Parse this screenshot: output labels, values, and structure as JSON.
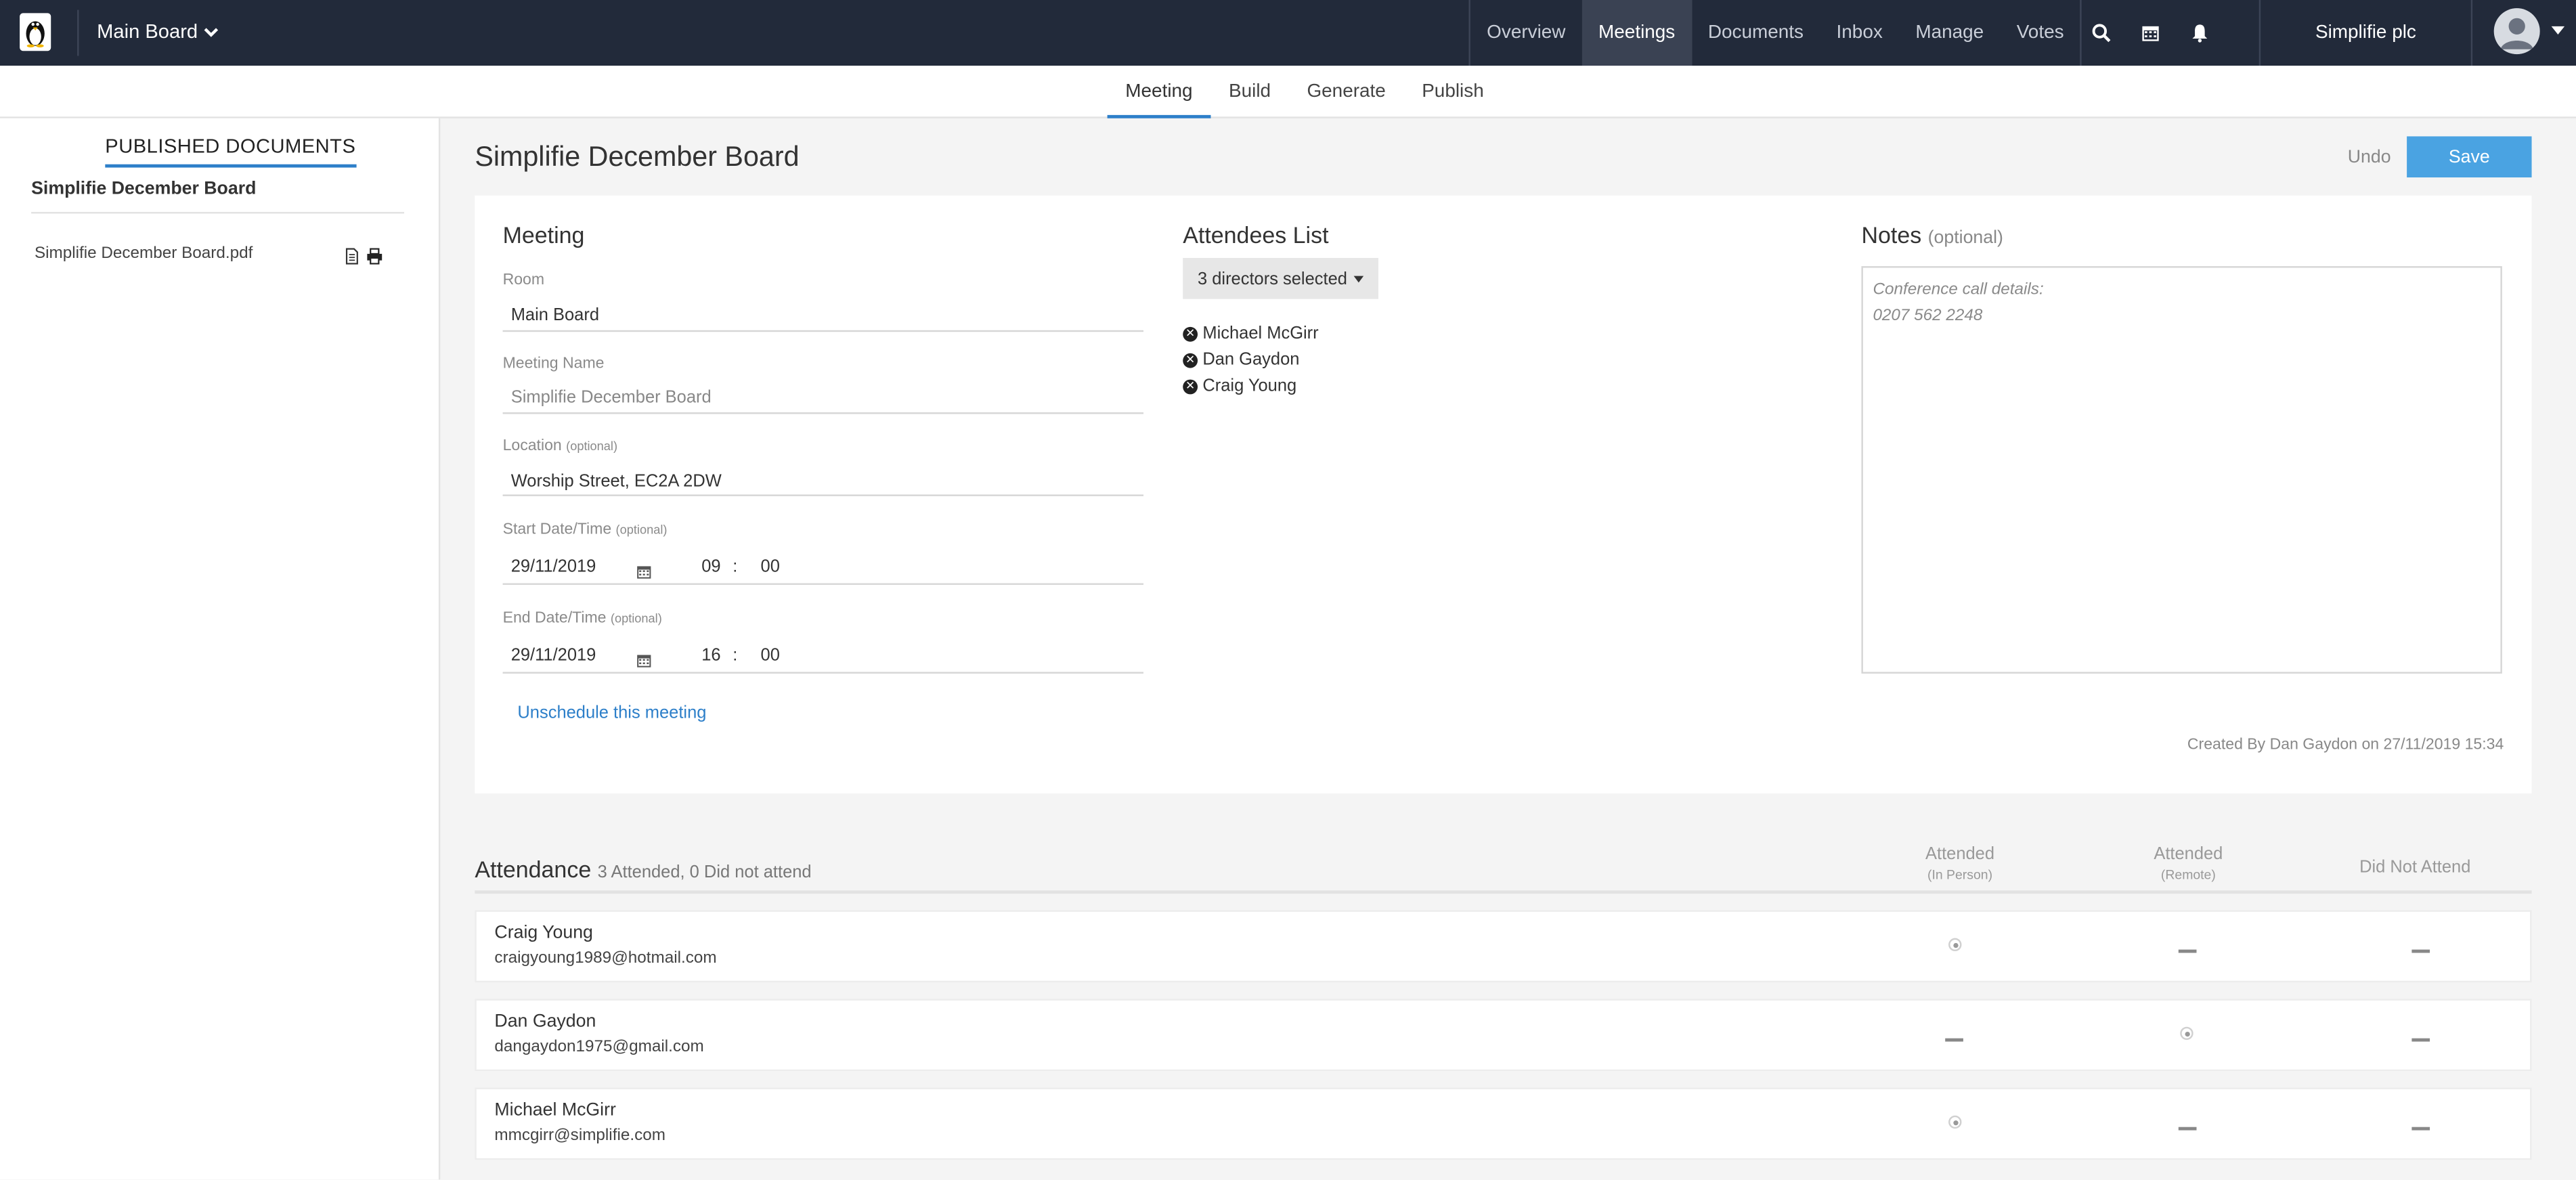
{
  "topbar": {
    "board": "Main Board",
    "nav": [
      "Overview",
      "Meetings",
      "Documents",
      "Inbox",
      "Manage",
      "Votes"
    ],
    "active_nav": "Meetings",
    "company": "Simplifie plc"
  },
  "subnav": {
    "tabs": [
      "Meeting",
      "Build",
      "Generate",
      "Publish"
    ],
    "active": "Meeting"
  },
  "sidebar": {
    "heading": "PUBLISHED DOCUMENTS",
    "board_name": "Simplifie December Board",
    "file_name": "Simplifie December Board.pdf"
  },
  "page": {
    "title": "Simplifie December Board",
    "undo": "Undo",
    "save": "Save"
  },
  "meeting": {
    "title": "Meeting",
    "room_label": "Room",
    "room_value": "Main Board",
    "name_label": "Meeting Name",
    "name_value": "Simplifie December Board",
    "location_label": "Location",
    "location_opt": "(optional)",
    "location_value": "Worship Street, EC2A 2DW",
    "start_label": "Start Date/Time",
    "start_opt": "(optional)",
    "start_date": "29/11/2019",
    "start_hour": "09",
    "start_min": "00",
    "end_label": "End Date/Time",
    "end_opt": "(optional)",
    "end_date": "29/11/2019",
    "end_hour": "16",
    "end_min": "00",
    "colon": ":",
    "unschedule": "Unschedule this meeting"
  },
  "attendees": {
    "title": "Attendees List",
    "dropdown": "3 directors selected",
    "list": [
      "Michael McGirr",
      "Dan Gaydon",
      "Craig Young"
    ]
  },
  "notes": {
    "title": "Notes",
    "opt": "(optional)",
    "line1": "Conference call details:",
    "line2": "0207 562 2248"
  },
  "created": "Created By Dan Gaydon on 27/11/2019 15:34",
  "attendance": {
    "title": "Attendance",
    "summary": "3 Attended, 0 Did not attend",
    "col1": "Attended",
    "col1_sub": "(In Person)",
    "col2": "Attended",
    "col2_sub": "(Remote)",
    "col3": "Did Not Attend",
    "rows": [
      {
        "name": "Craig Young",
        "email": "craigyoung1989@hotmail.com",
        "status": "in_person"
      },
      {
        "name": "Dan Gaydon",
        "email": "dangaydon1975@gmail.com",
        "status": "remote"
      },
      {
        "name": "Michael McGirr",
        "email": "mmcgirr@simplifie.com",
        "status": "in_person"
      }
    ]
  },
  "colors": {
    "topbar": "#222a3a",
    "accent": "#2d7fc9",
    "save": "#4aa3e2"
  }
}
